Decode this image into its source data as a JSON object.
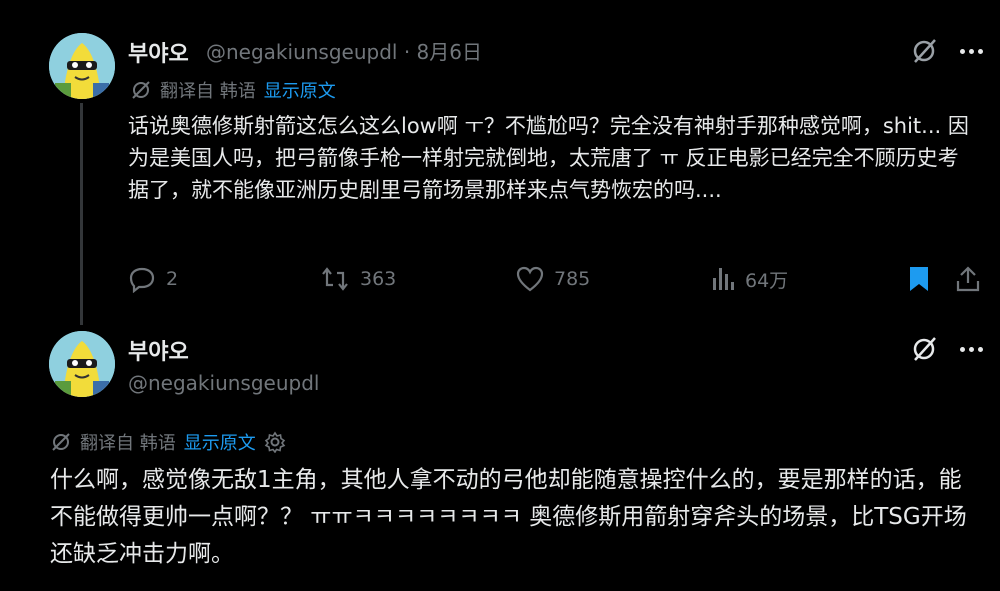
{
  "tweet1": {
    "display_name": "부야오",
    "handle_date": "@negakiunsgeupdl · 8月6日",
    "translated_from": "翻译自 韩语",
    "show_original": "显示原文",
    "text": "话说奥德修斯射箭这怎么这么low啊 ㅜ？不尴尬吗？完全没有神射手那种感觉啊，shit... 因为是美国人吗，把弓箭像手枪一样射完就倒地，太荒唐了 ㅠ 反正电影已经完全不顾历史考据了，就不能像亚洲历史剧里弓箭场景那样来点气势恢宏的吗....",
    "replies": "2",
    "reposts": "363",
    "likes": "785",
    "views": "64万"
  },
  "tweet2": {
    "display_name": "부야오",
    "handle": "@negakiunsgeupdl",
    "translated_from": "翻译自 韩语",
    "show_original": "显示原文",
    "text": "什么啊，感觉像无敌1主角，其他人拿不动的弓他却能随意操控什么的，要是那样的话，能不能做得更帅一点啊？？ ㅠㅠㅋㅋㅋㅋㅋㅋㅋㅋ 奥德修斯用箭射穿斧头的场景，比TSG开场还缺乏冲击力啊。"
  },
  "colors": {
    "background": "#000000",
    "text": "#e7e9ea",
    "muted": "#71767b",
    "link": "#1d9bf0",
    "bookmark": "#1d9bf0"
  },
  "icons": {
    "grok": "grok-icon",
    "more": "more-icon",
    "translate": "translate-icon",
    "settings": "gear-icon",
    "reply": "reply-icon",
    "repost": "repost-icon",
    "like": "heart-icon",
    "views": "views-icon",
    "bookmark": "bookmark-icon",
    "share": "share-icon"
  }
}
